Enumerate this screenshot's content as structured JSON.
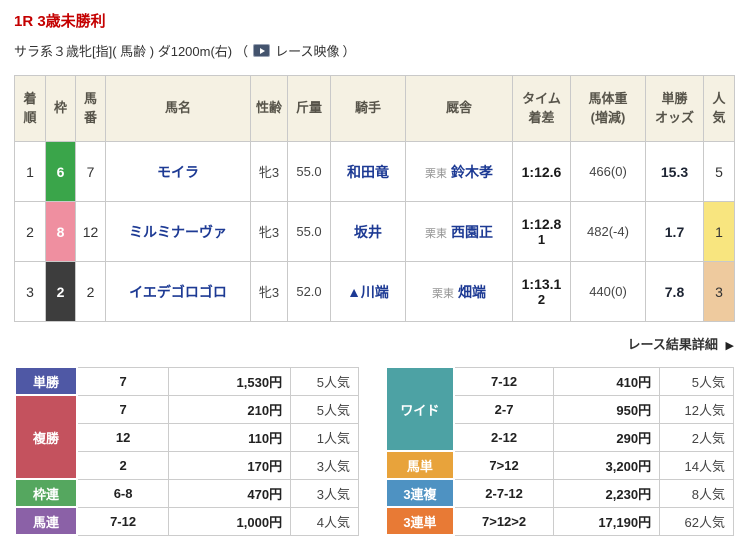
{
  "header": {
    "race_title": "1R 3歳未勝利",
    "race_conditions": "サラ系３歳牝[指]( 馬齢 ) ダ1200m(右)",
    "paren_open": "（",
    "video_link": "レース映像",
    "paren_close": "）",
    "detail_link": "レース結果詳細",
    "detail_arrow": "▶"
  },
  "results": {
    "headers": [
      {
        "lines": [
          "着",
          "順"
        ]
      },
      {
        "lines": [
          "枠"
        ]
      },
      {
        "lines": [
          "馬",
          "番"
        ]
      },
      {
        "lines": [
          "馬名"
        ]
      },
      {
        "lines": [
          "性齢"
        ]
      },
      {
        "lines": [
          "斤量"
        ]
      },
      {
        "lines": [
          "騎手"
        ]
      },
      {
        "lines": [
          "厩舎"
        ]
      },
      {
        "lines": [
          "タイム",
          "着差"
        ]
      },
      {
        "lines": [
          "馬体重",
          "(増減)"
        ]
      },
      {
        "lines": [
          "単勝",
          "オッズ"
        ]
      },
      {
        "lines": [
          "人",
          "気"
        ]
      }
    ],
    "rows": [
      {
        "rank": "1",
        "frame": "6",
        "frame_color": "#3aa54a",
        "horse_number": "7",
        "horse_name": "モイラ",
        "sex_age": "牝3",
        "weight": "55.0",
        "jockey": "和田竜",
        "stable_region": "栗東",
        "trainer": "鈴木孝",
        "time": "1:12.6",
        "margin": "",
        "horse_weight": "466(0)",
        "odds": "15.3",
        "popularity": "5",
        "popularity_bg": "#ffffff"
      },
      {
        "rank": "2",
        "frame": "8",
        "frame_color": "#ef8fa0",
        "horse_number": "12",
        "horse_name": "ミルミナーヴァ",
        "sex_age": "牝3",
        "weight": "55.0",
        "jockey": "坂井",
        "stable_region": "栗東",
        "trainer": "西園正",
        "time": "1:12.8",
        "margin": "1",
        "horse_weight": "482(-4)",
        "odds": "1.7",
        "popularity": "1",
        "popularity_bg": "#f8e57f"
      },
      {
        "rank": "3",
        "frame": "2",
        "frame_color": "#3d3d3d",
        "horse_number": "2",
        "horse_name": "イエデゴロゴロ",
        "sex_age": "牝3",
        "weight": "52.0",
        "jockey": "▲川端",
        "stable_region": "栗東",
        "trainer": "畑端",
        "time": "1:13.1",
        "margin": "2",
        "horse_weight": "440(0)",
        "odds": "7.8",
        "popularity": "3",
        "popularity_bg": "#eeca9e"
      }
    ]
  },
  "payouts_left": {
    "groups": [
      {
        "label": "単勝",
        "color": "#4f58a5",
        "entries": [
          {
            "comb": "7",
            "amount": "1,530円",
            "pop": "5人気"
          }
        ]
      },
      {
        "label": "複勝",
        "color": "#c4525e",
        "entries": [
          {
            "comb": "7",
            "amount": "210円",
            "pop": "5人気"
          },
          {
            "comb": "12",
            "amount": "110円",
            "pop": "1人気"
          },
          {
            "comb": "2",
            "amount": "170円",
            "pop": "3人気"
          }
        ]
      },
      {
        "label": "枠連",
        "color": "#55a75f",
        "entries": [
          {
            "comb": "6-8",
            "amount": "470円",
            "pop": "3人気"
          }
        ]
      },
      {
        "label": "馬連",
        "color": "#8b61a7",
        "entries": [
          {
            "comb": "7-12",
            "amount": "1,000円",
            "pop": "4人気"
          }
        ]
      }
    ]
  },
  "payouts_right": {
    "groups": [
      {
        "label": "ワイド",
        "color": "#4da2a4",
        "entries": [
          {
            "comb": "7-12",
            "amount": "410円",
            "pop": "5人気"
          },
          {
            "comb": "2-7",
            "amount": "950円",
            "pop": "12人気"
          },
          {
            "comb": "2-12",
            "amount": "290円",
            "pop": "2人気"
          }
        ]
      },
      {
        "label": "馬単",
        "color": "#e8a33b",
        "entries": [
          {
            "comb": "7>12",
            "amount": "3,200円",
            "pop": "14人気"
          }
        ]
      },
      {
        "label": "3連複",
        "color": "#4e92c2",
        "entries": [
          {
            "comb": "2-7-12",
            "amount": "2,230円",
            "pop": "8人気"
          }
        ]
      },
      {
        "label": "3連単",
        "color": "#e87a35",
        "entries": [
          {
            "comb": "7>12>2",
            "amount": "17,190円",
            "pop": "62人気"
          }
        ]
      }
    ]
  }
}
